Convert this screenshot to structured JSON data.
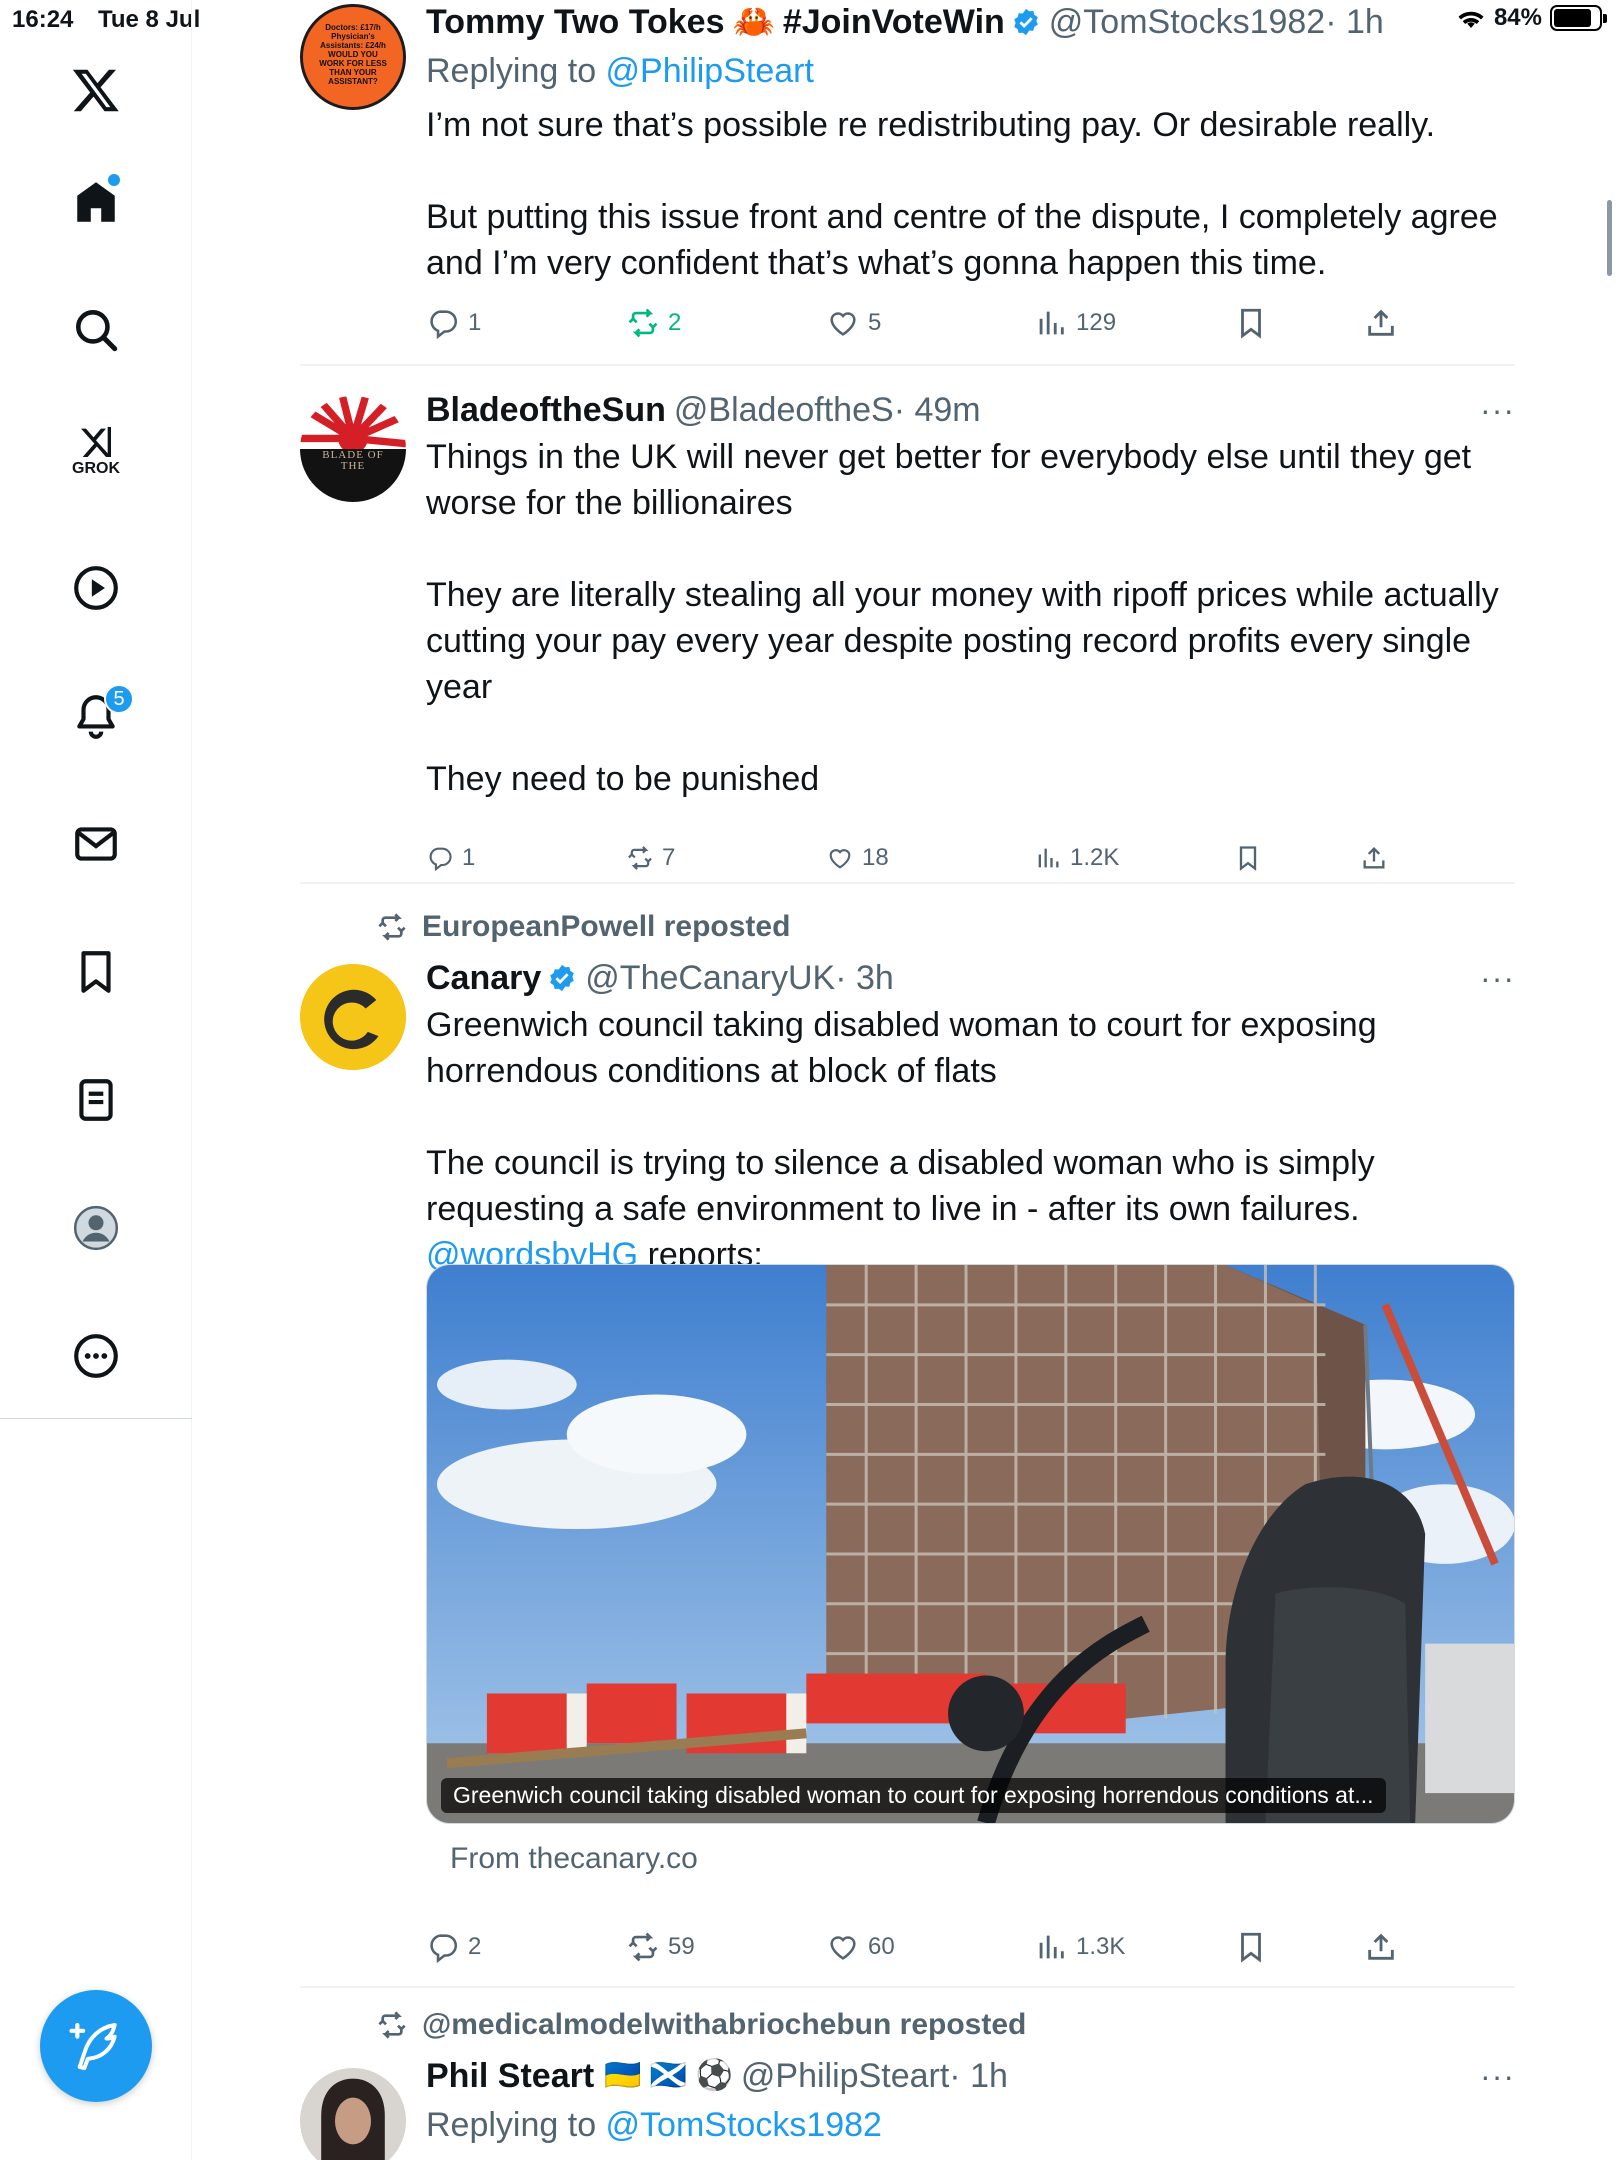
{
  "status_bar": {
    "time": "16:24",
    "date": "Tue 8 Jul",
    "battery": "84%",
    "battery_level": 0.84
  },
  "sidebar": {
    "grok_label": "GROK",
    "notifications_count": "5"
  },
  "tweets": [
    {
      "name": "Tommy Two Tokes",
      "name_extra": "#JoinVoteWin",
      "handle": "@TomStocks1982",
      "time": "· 1h",
      "replying_prefix": "Replying to ",
      "replying_handle": "@PhilipSteart",
      "avatar_text": "Doctors: £17/h Physician's Assistants: £24/h WOULD YOU WORK FOR LESS THAN YOUR ASSISTANT?",
      "body": [
        "I’m not sure that’s possible re redistributing pay. Or desirable really.",
        "But putting this issue front and centre of the dispute, I completely agree and I’m very confident that’s what’s gonna happen this time."
      ],
      "stats": {
        "replies": "1",
        "reposts": "2",
        "likes": "5",
        "views": "129"
      }
    },
    {
      "name": "BladeoftheSun",
      "handle": "@BladeoftheS",
      "time": "· 49m",
      "more": "···",
      "avatar_text": "BLADE OF THE",
      "body": [
        "Things in the UK will never get better for everybody else until they get worse for the billionaires",
        "They are literally stealing all your money with ripoff prices while actually cutting your pay every year despite posting record profits every single year",
        "They need to be punished"
      ],
      "stats": {
        "replies": "1",
        "reposts": "7",
        "likes": "18",
        "views": "1.2K"
      }
    },
    {
      "reposted_by": "EuropeanPowell reposted",
      "name": "Canary",
      "handle": "@TheCanaryUK",
      "time": "· 3h",
      "more": "···",
      "body": [
        "Greenwich council taking disabled woman to court for exposing horrendous conditions at block of flats",
        "The council is trying to silence a disabled woman who is simply requesting a safe environment to live in - after its own failures."
      ],
      "mention": "@wordsbyHG",
      "mention_suffix": " reports:",
      "card_caption": "Greenwich council taking disabled woman to court for exposing horrendous conditions at...",
      "card_source": "From thecanary.co",
      "stats": {
        "replies": "2",
        "reposts": "59",
        "likes": "60",
        "views": "1.3K"
      }
    },
    {
      "reposted_by": "@medicalmodelwithabriochebun reposted",
      "name": "Phil Steart",
      "name_extra": "🇺🇦 🏴󠁧󠁢󠁳󠁣󠁴󠁿 ⚽",
      "handle": "@PhilipSteart",
      "time": "· 1h",
      "more": "···",
      "replying_prefix": "Replying to ",
      "replying_handle": "@TomStocks1982"
    }
  ],
  "colors": {
    "accent": "#1d9bf0",
    "repost_active": "#00ba7c",
    "muted": "#536471"
  },
  "icons": [
    "x-logo-icon",
    "home-icon",
    "search-icon",
    "grok-icon",
    "video-icon",
    "bell-icon",
    "mail-icon",
    "bookmark-icon",
    "lists-icon",
    "profile-icon",
    "more-icon",
    "compose-icon",
    "reply-icon",
    "repost-icon",
    "like-icon",
    "views-icon",
    "share-icon",
    "verified-icon"
  ]
}
